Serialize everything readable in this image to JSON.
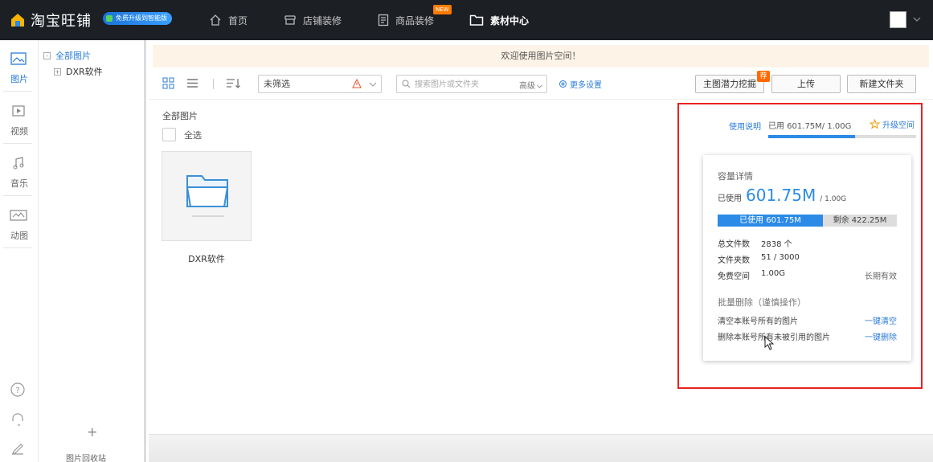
{
  "header": {
    "brand": "淘宝旺铺",
    "upgrade_badge": "免费升级到智能版",
    "nav": [
      {
        "label": "首页",
        "icon": "home-icon"
      },
      {
        "label": "店铺装修",
        "icon": "store-icon"
      },
      {
        "label": "商品装修",
        "icon": "document-icon",
        "tag": "NEW"
      },
      {
        "label": "素材中心",
        "icon": "folder-icon",
        "active": true
      }
    ]
  },
  "rail": {
    "items": [
      {
        "label": "图片",
        "icon": "image-icon",
        "active": true
      },
      {
        "label": "视频",
        "icon": "video-icon"
      },
      {
        "label": "音乐",
        "icon": "music-icon"
      },
      {
        "label": "动图",
        "icon": "gif-icon"
      }
    ],
    "bottom_icons": [
      "help-icon",
      "headset-icon",
      "edit-icon"
    ]
  },
  "tree": {
    "root": {
      "label": "全部图片",
      "toggle": "-"
    },
    "children": [
      {
        "label": "DXR软件",
        "toggle": "+"
      }
    ],
    "add_label": "+",
    "recycle_label": "图片回收站"
  },
  "main": {
    "welcome": "欢迎使用图片空间！",
    "filter": {
      "value": "未筛选"
    },
    "search": {
      "placeholder": "搜索图片或文件夹",
      "advanced": "高级"
    },
    "more_settings": "更多设置",
    "buttons": {
      "analyze": "主图潜力挖掘",
      "analyze_badge": "荐",
      "upload": "上传",
      "new_folder": "新建文件夹"
    },
    "content_title": "全部图片",
    "select_all": "全选",
    "folders": [
      {
        "name": "DXR软件"
      }
    ]
  },
  "storage": {
    "help_link": "使用说明",
    "used_text": "已用 601.75M/ 1.00G",
    "used_fraction": 0.5876,
    "upgrade_link": "升级空间",
    "popover": {
      "title": "容量详情",
      "used_label": "已使用",
      "used_value": "601.75M",
      "total": "/ 1.00G",
      "bar_used": "已使用 601.75M",
      "bar_rest": "剩余 422.25M",
      "rows": [
        {
          "key": "总文件数",
          "value": "2838 个",
          "right": ""
        },
        {
          "key": "文件夹数",
          "value": "51 / 3000",
          "right": ""
        },
        {
          "key": "免费空间",
          "value": "1.00G",
          "right": "长期有效"
        }
      ],
      "bulk_title": "批量删除（谨慎操作）",
      "actions": [
        {
          "text": "清空本账号所有的图片",
          "action": "一键清空"
        },
        {
          "text": "删除本账号所有未被引用的图片",
          "action": "一键删除"
        }
      ]
    }
  },
  "colors": {
    "accent": "#2b8be6",
    "topbar": "#1c1f24",
    "highlight_frame": "#e8231e",
    "badge": "#ff6a00"
  }
}
